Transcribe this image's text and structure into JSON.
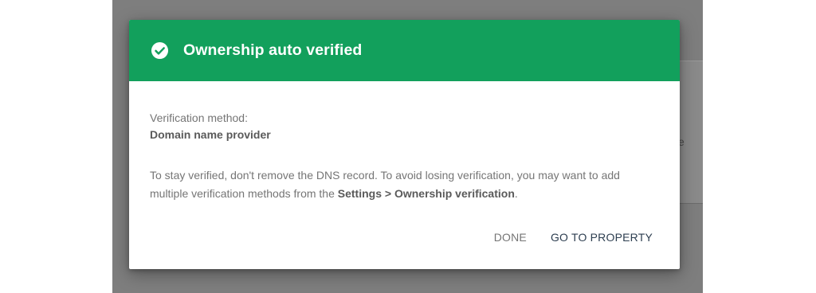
{
  "background": {
    "card_text": "e"
  },
  "dialog": {
    "title": "Ownership auto verified",
    "header_color": "#12a05c",
    "icon": "check-circle-icon",
    "method_label": "Verification method:",
    "method_value": "Domain name provider",
    "info_text_before": "To stay verified, don't remove the DNS record. To avoid losing verification, you may want to add multiple verification methods from the ",
    "info_text_bold": "Settings > Ownership verification",
    "info_text_after": ".",
    "actions": {
      "done_label": "DONE",
      "go_label": "GO TO PROPERTY"
    }
  }
}
